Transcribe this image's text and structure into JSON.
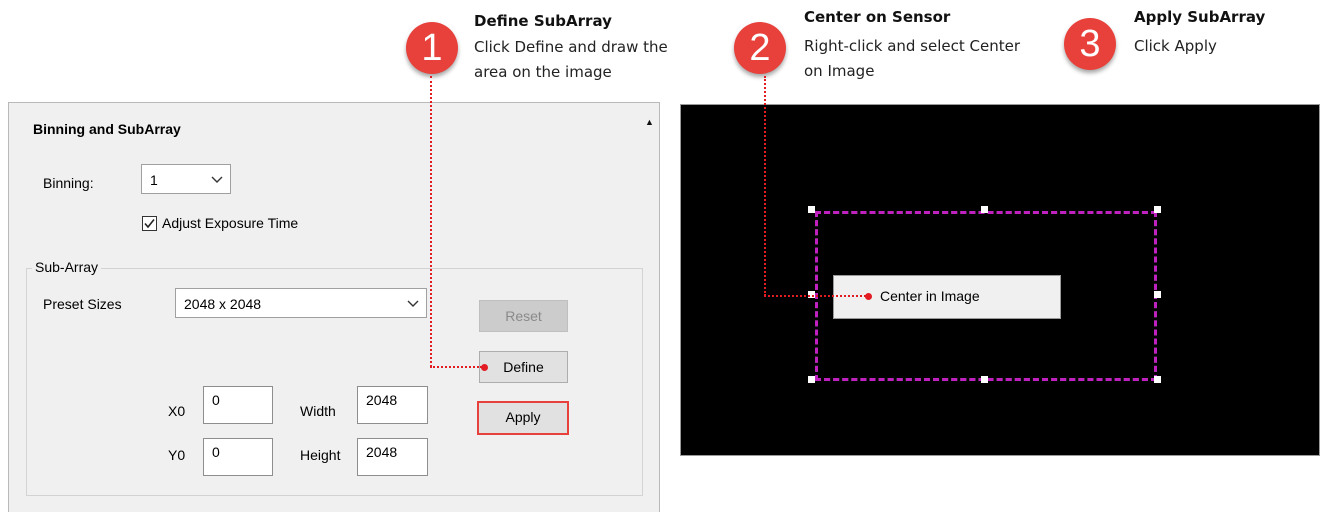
{
  "steps": [
    {
      "number": "1",
      "title": "Define SubArray",
      "description": "Click Define and draw the area on the image"
    },
    {
      "number": "2",
      "title": "Center on Sensor",
      "description": "Right-click and select Center on Image"
    },
    {
      "number": "3",
      "title": "Apply SubArray",
      "description": "Click Apply"
    }
  ],
  "panel": {
    "title": "Binning and SubArray",
    "binning_label": "Binning:",
    "binning_value": "1",
    "adjust_exposure_label": "Adjust Exposure Time",
    "adjust_exposure_checked": true,
    "subarray_group_label": "Sub-Array",
    "preset_label": "Preset Sizes",
    "preset_value": "2048 x 2048",
    "x0_label": "X0",
    "x0_value": "0",
    "y0_label": "Y0",
    "y0_value": "0",
    "width_label": "Width",
    "width_value": "2048",
    "height_label": "Height",
    "height_value": "2048",
    "reset_button": "Reset",
    "define_button": "Define",
    "apply_button": "Apply"
  },
  "image_view": {
    "context_menu_item": "Center in Image"
  },
  "colors": {
    "badge": "#e8413b",
    "callout_line": "#e31b23",
    "roi_green": "#3aa53a",
    "roi_magenta": "#c020c0"
  },
  "icons": [
    "chevron-down-icon",
    "check-icon",
    "collapse-arrow-icon"
  ]
}
